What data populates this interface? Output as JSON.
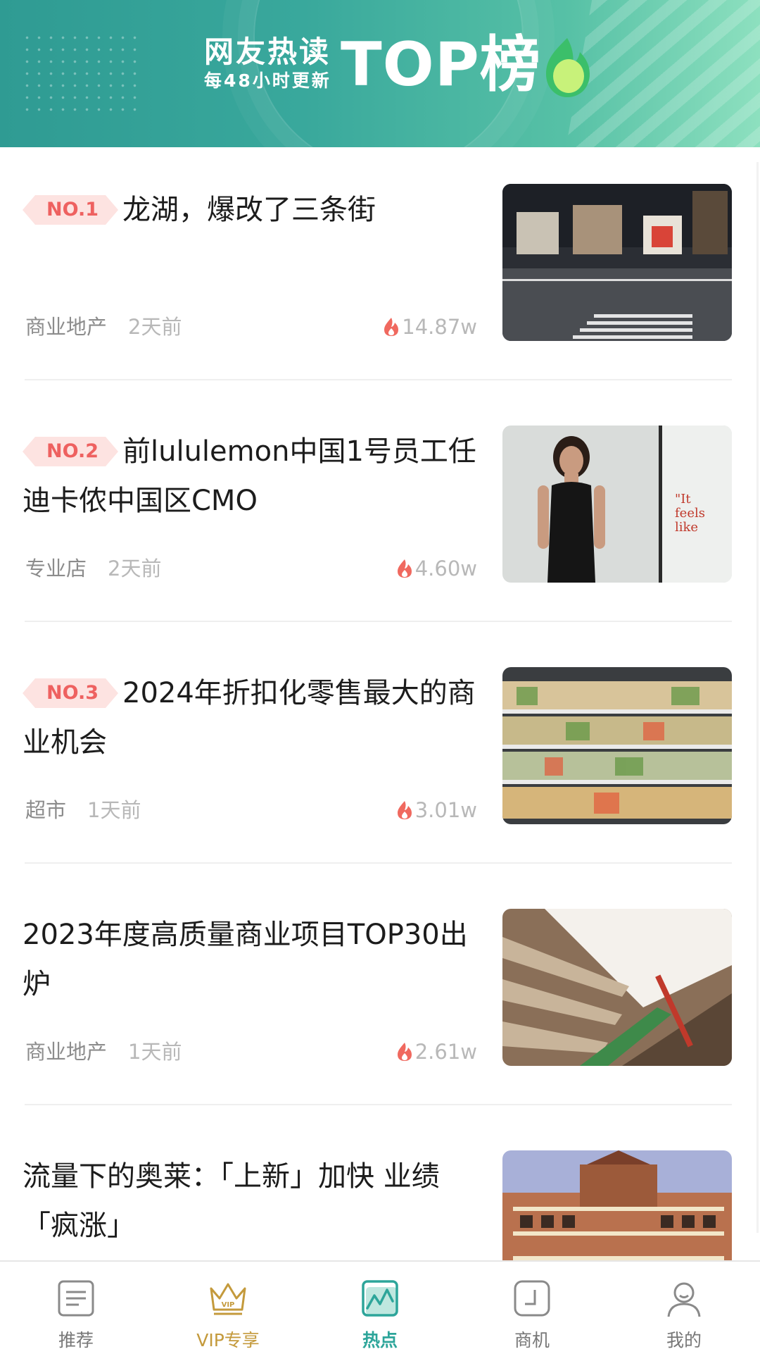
{
  "banner": {
    "line1": "网友热读",
    "line2": "每48小时更新",
    "title": "TOP榜"
  },
  "articles": [
    {
      "rank": "NO.1",
      "title": "龙湖，爆改了三条街",
      "category": "商业地产",
      "time": "2天前",
      "heat": "14.87w",
      "image": "street-food-court-photo"
    },
    {
      "rank": "NO.2",
      "title": "前lululemon中国1号员工任迪卡侬中国区CMO",
      "category": "专业店",
      "time": "2天前",
      "heat": "4.60w",
      "image": "woman-portrait-photo"
    },
    {
      "rank": "NO.3",
      "title": "2024年折扣化零售最大的商业机会",
      "category": "超市",
      "time": "1天前",
      "heat": "3.01w",
      "image": "supermarket-shelves-photo"
    },
    {
      "rank": "",
      "title": "2023年度高质量商业项目TOP30出炉",
      "category": "商业地产",
      "time": "1天前",
      "heat": "2.61w",
      "image": "mall-atrium-photo"
    },
    {
      "rank": "",
      "title": "流量下的奥莱：「上新」加快 业绩「疯涨」",
      "category": "",
      "time": "",
      "heat": "",
      "image": "outlet-building-photo"
    }
  ],
  "tabs": [
    {
      "label": "推荐",
      "icon": "article-icon"
    },
    {
      "label": "VIP专享",
      "icon": "crown-icon"
    },
    {
      "label": "热点",
      "icon": "trend-chart-icon"
    },
    {
      "label": "商机",
      "icon": "square-icon"
    },
    {
      "label": "我的",
      "icon": "user-icon"
    }
  ],
  "colors": {
    "accent": "#2da59a",
    "rank_bg": "#fde3e1",
    "rank_text": "#ee6160",
    "flame": "#f0695f",
    "vip": "#c49a3c"
  }
}
